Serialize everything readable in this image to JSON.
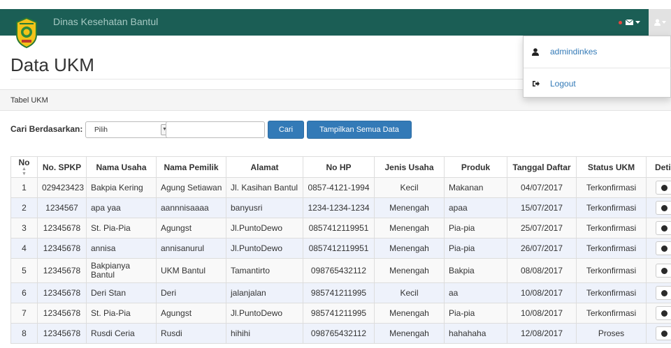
{
  "header": {
    "brand": "Dinas Kesehatan Bantul",
    "mail_icon": "envelope-icon",
    "user_icon": "user-icon"
  },
  "dropdown": {
    "user_label": "admindinkes",
    "logout_label": "Logout"
  },
  "page": {
    "title": "Data UKM",
    "panel_title": "Tabel UKM"
  },
  "search": {
    "label": "Cari Berdasarkan:",
    "select_value": "Pilih",
    "input_value": "",
    "search_button": "Cari",
    "show_all_button": "Tampilkan Semua Data"
  },
  "table": {
    "columns": [
      "No",
      "No. SPKP",
      "Nama Usaha",
      "Nama Pemilik",
      "Alamat",
      "No HP",
      "Jenis Usaha",
      "Produk",
      "Tanggal Daftar",
      "Status UKM",
      "Detil"
    ],
    "rows": [
      [
        "1",
        "029423423",
        "Bakpia Kering",
        "Agung Setiawan",
        "Jl. Kasihan Bantul",
        "0857-4121-1994",
        "Kecil",
        "Makanan",
        "04/07/2017",
        "Terkonfirmasi"
      ],
      [
        "2",
        "1234567",
        "apa yaa",
        "aannnisaaaa",
        "banyusri",
        "1234-1234-1234",
        "Menengah",
        "apaa",
        "15/07/2017",
        "Terkonfirmasi"
      ],
      [
        "3",
        "12345678",
        "St. Pia-Pia",
        "Agungst",
        "Jl.PuntoDewo",
        "0857412119951",
        "Menengah",
        "Pia-pia",
        "25/07/2017",
        "Terkonfirmasi"
      ],
      [
        "4",
        "12345678",
        "annisa",
        "annisanurul",
        "Jl.PuntoDewo",
        "0857412119951",
        "Menengah",
        "Pia-pia",
        "26/07/2017",
        "Terkonfirmasi"
      ],
      [
        "5",
        "12345678",
        "Bakpianya Bantul",
        "UKM Bantul",
        "Tamantirto",
        "098765432112",
        "Menengah",
        "Bakpia",
        "08/08/2017",
        "Terkonfirmasi"
      ],
      [
        "6",
        "12345678",
        "Deri Stan",
        "Deri",
        "jalanjalan",
        "985741211995",
        "Kecil",
        "aa",
        "10/08/2017",
        "Terkonfirmasi"
      ],
      [
        "7",
        "12345678",
        "St. Pia-Pia",
        "Agungst",
        "Jl.PuntoDewo",
        "985741211995",
        "Menengah",
        "Pia-pia",
        "10/08/2017",
        "Terkonfirmasi"
      ],
      [
        "8",
        "12345678",
        "Rusdi Ceria",
        "Rusdi",
        "hihihi",
        "098765432112",
        "Menengah",
        "hahahaha",
        "12/08/2017",
        "Proses"
      ]
    ]
  },
  "colors": {
    "navbar": "#1b5e55",
    "primary": "#337ab7",
    "alert_dot": "#e8463f"
  }
}
